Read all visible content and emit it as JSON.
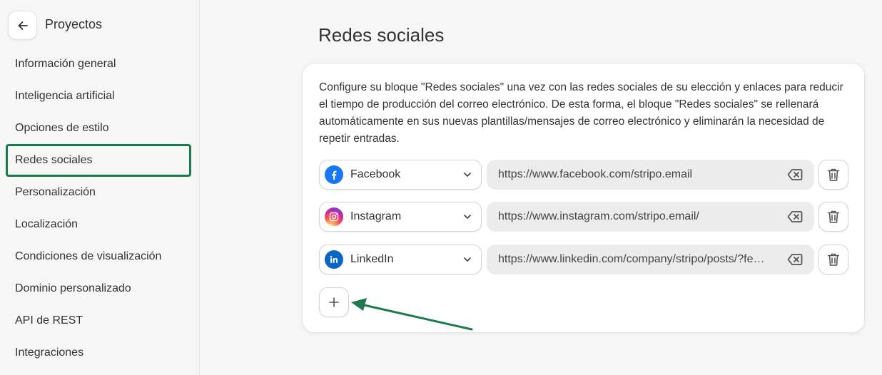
{
  "sidebar": {
    "title": "Proyectos",
    "items": [
      {
        "label": "Información general"
      },
      {
        "label": "Inteligencia artificial"
      },
      {
        "label": "Opciones de estilo"
      },
      {
        "label": "Redes sociales",
        "active": true
      },
      {
        "label": "Personalización"
      },
      {
        "label": "Localización"
      },
      {
        "label": "Condiciones de visualización"
      },
      {
        "label": "Dominio personalizado"
      },
      {
        "label": "API de REST"
      },
      {
        "label": "Integraciones"
      }
    ]
  },
  "main": {
    "title": "Redes sociales",
    "description": "Configure su bloque \"Redes sociales\" una vez con las redes sociales de su elección y enlaces para reducir el tiempo de producción del correo electrónico. De esta forma, el bloque \"Redes sociales\" se rellenará automáticamente en sus nuevas plantillas/mensajes de correo electrónico y eliminarán la necesidad de repetir entradas.",
    "networks": [
      {
        "network": "Facebook",
        "url": "https://www.facebook.com/stripo.email",
        "icon": "facebook-icon",
        "color": "#1877f2"
      },
      {
        "network": "Instagram",
        "url": "https://www.instagram.com/stripo.email/",
        "icon": "instagram-icon",
        "color": "#d6249f"
      },
      {
        "network": "LinkedIn",
        "url": "https://www.linkedin.com/company/stripo/posts/?feedView=all",
        "icon": "linkedin-icon",
        "color": "#0a66c2"
      }
    ]
  },
  "colors": {
    "accent": "#1d7a4f",
    "background": "#f6f6f6",
    "field": "#ececec"
  }
}
